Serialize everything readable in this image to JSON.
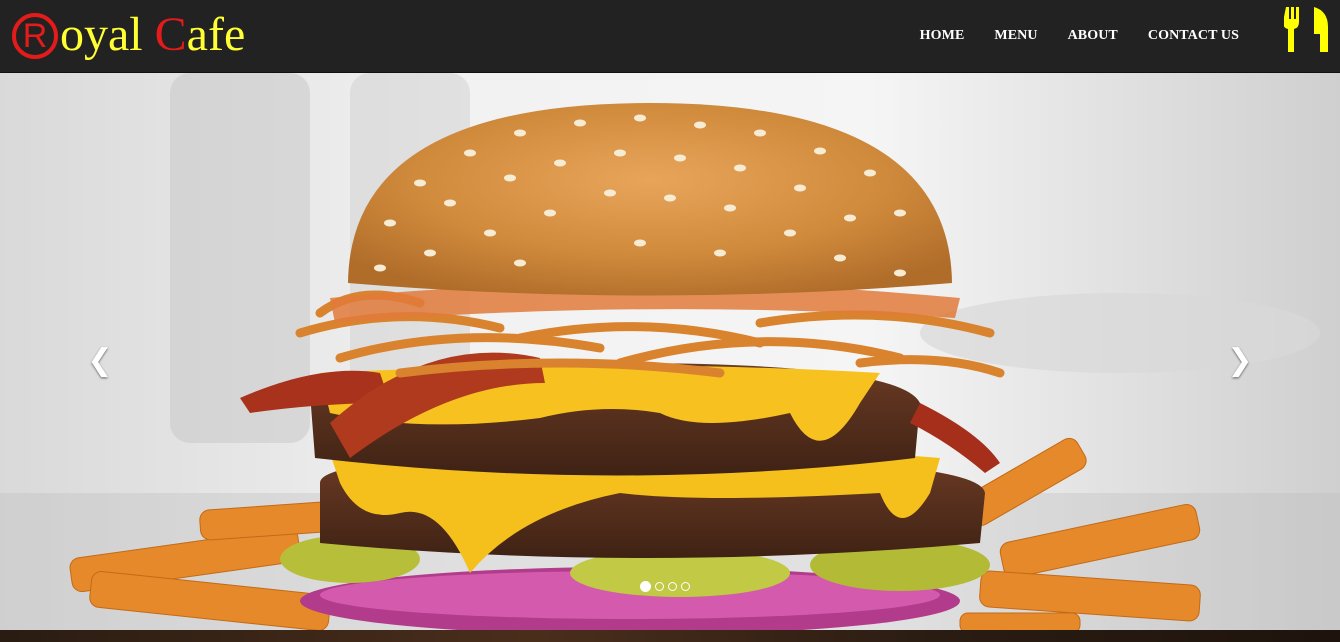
{
  "brand": {
    "reg_symbol": "R",
    "part1": "oyal ",
    "letter2": "C",
    "part2": "afe",
    "colors": {
      "text": "#ffff33",
      "accent": "#e31b1b"
    }
  },
  "nav": {
    "items": [
      "HOME",
      "MENU",
      "ABOUT",
      "CONTACT US"
    ],
    "icon": "fork-knife-icon"
  },
  "carousel": {
    "prev_icon": "chevron-left-icon",
    "next_icon": "chevron-right-icon",
    "prev_glyph": "❮",
    "next_glyph": "❯",
    "slide_count": 4,
    "active_slide": 1,
    "image": "burger-photo"
  },
  "colors": {
    "navbar": "#222222"
  }
}
